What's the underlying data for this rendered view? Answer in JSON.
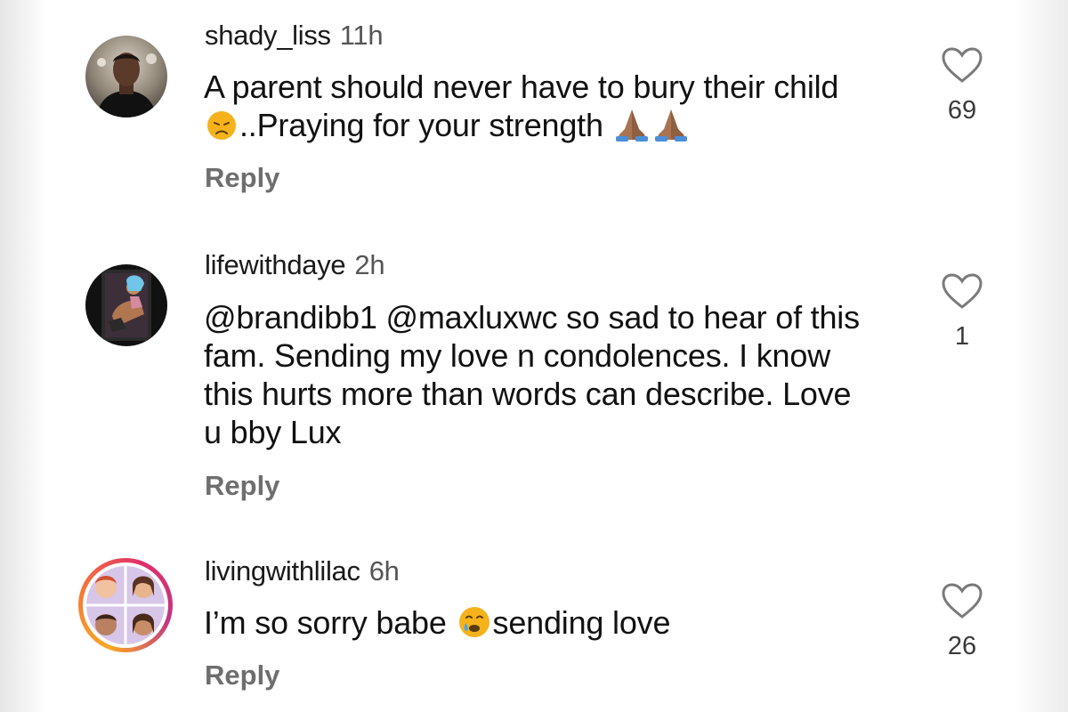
{
  "comments": [
    {
      "username": "shady_liss",
      "time": "11h",
      "line1": "A parent should never have to bury their child",
      "line2": "..Praying for your strength",
      "reply": "Reply",
      "likes": "69",
      "icons": [
        "disappointed-face-emoji",
        "folded-hands-emoji",
        "folded-hands-emoji"
      ]
    },
    {
      "username": "lifewithdaye",
      "time": "2h",
      "mention1": "@brandibb1",
      "mention2": "@maxluxwc",
      "line1_rest": "so sad to hear of this",
      "line2": "fam. Sending my love n condolences. I know",
      "line3": "this hurts more than words can describe. Love",
      "line4": "u bby Lux",
      "reply": "Reply",
      "likes": "1"
    },
    {
      "username": "livingwithlilac",
      "time": "6h",
      "text_before": "I’m so sorry babe",
      "text_after": "sending love",
      "reply": "Reply",
      "likes": "26",
      "icons": [
        "crying-face-emoji"
      ]
    }
  ],
  "colors": {
    "text": "#111111",
    "meta": "#6e6e6e",
    "emoji_yellow": "#f5b21b",
    "hands": "#a87452"
  }
}
